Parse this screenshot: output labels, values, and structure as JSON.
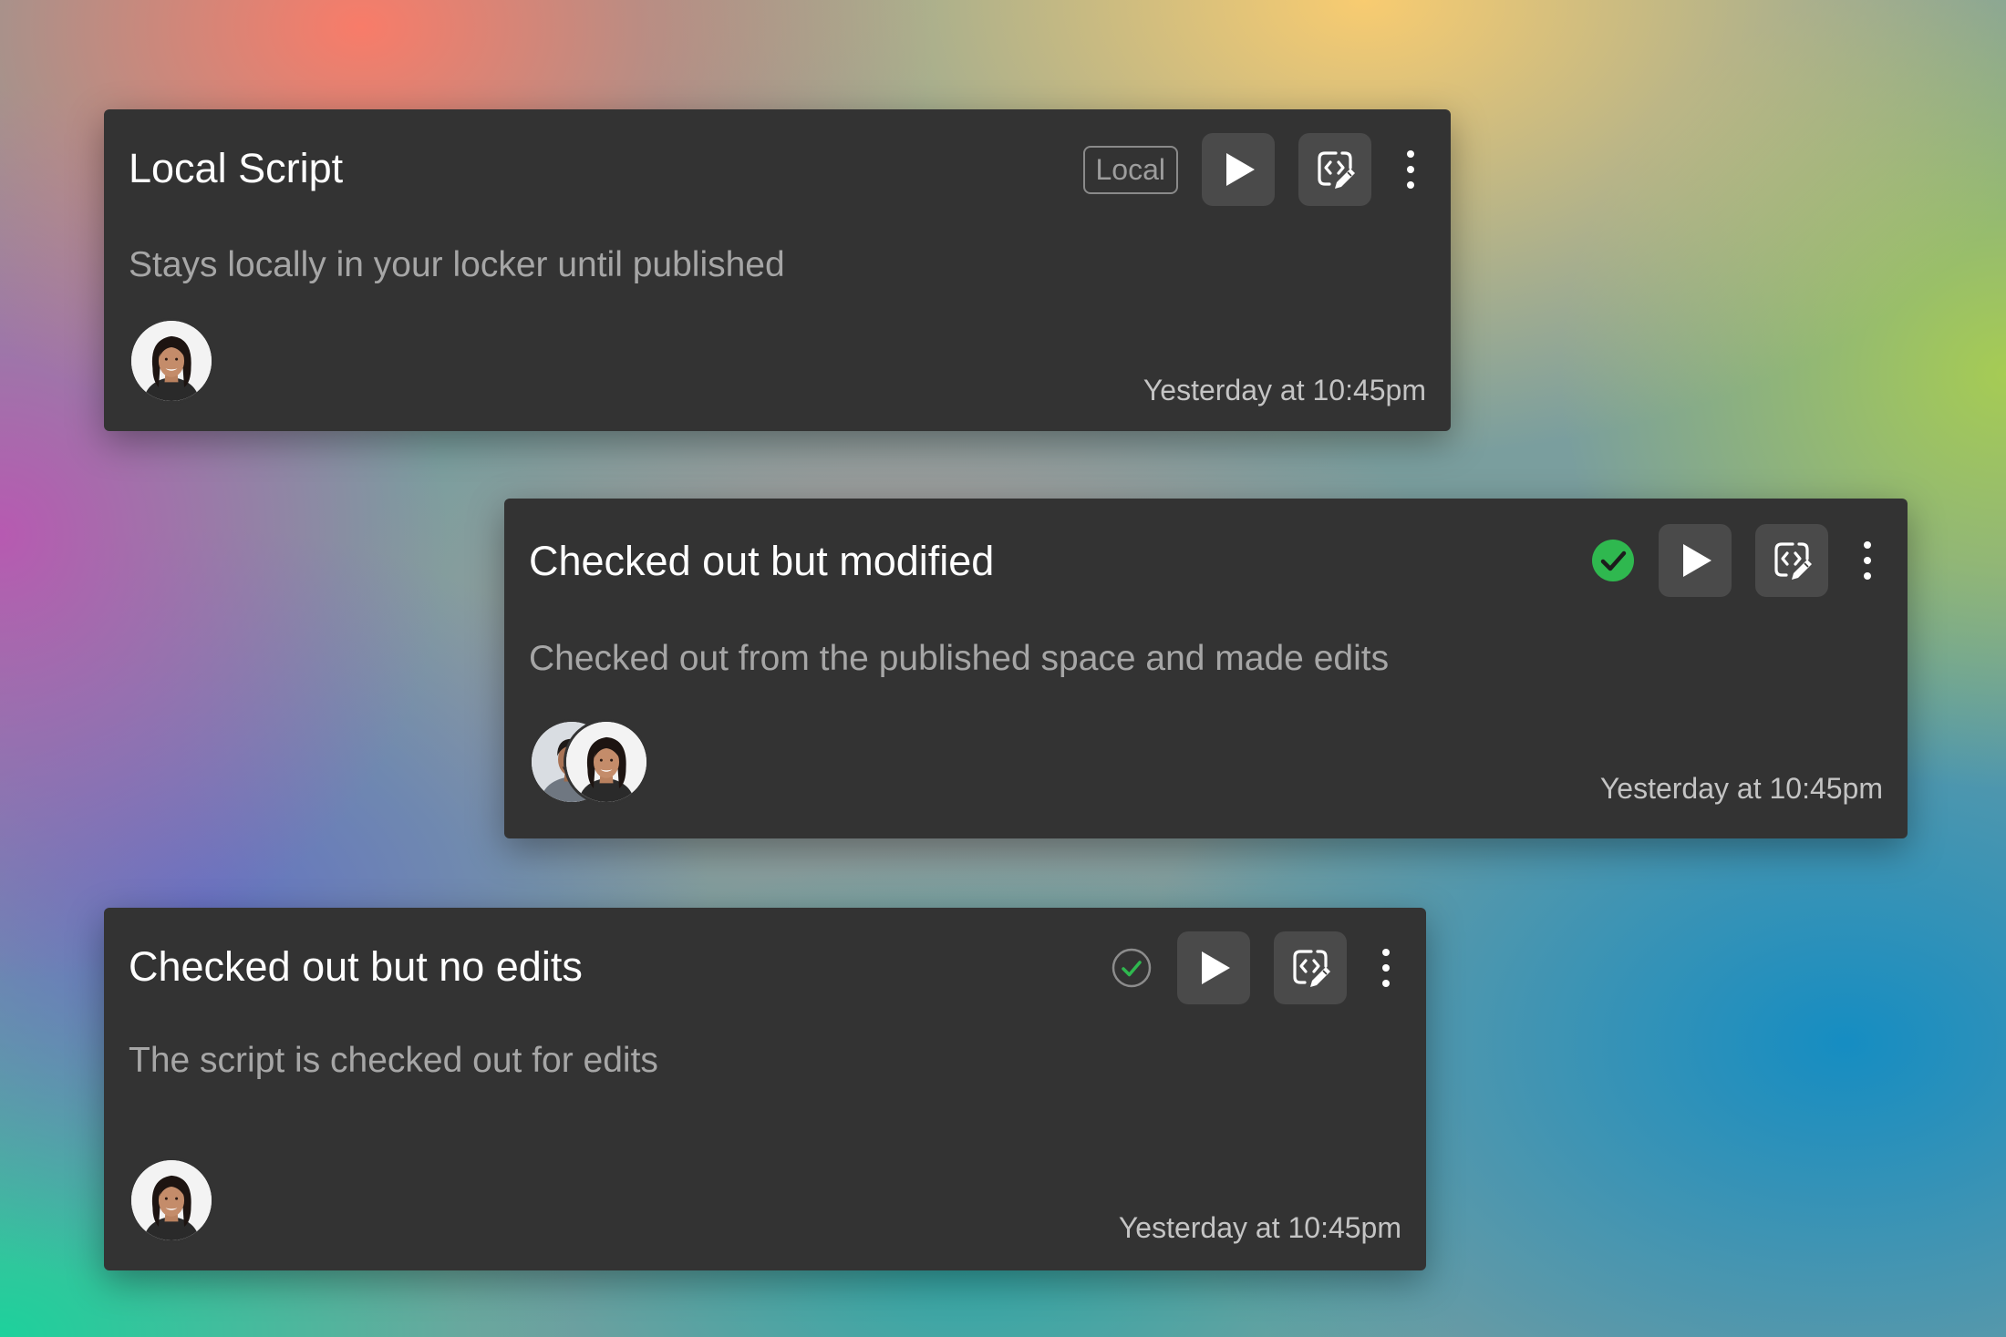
{
  "cards": [
    {
      "title": "Local Script",
      "description": "Stays locally in your locker until published",
      "badge": "Local",
      "status": "local",
      "timestamp": "Yesterday at 10:45pm",
      "avatars": [
        "woman-avatar"
      ],
      "actions": [
        "play-icon",
        "code-edit-icon",
        "more-vertical-icon"
      ]
    },
    {
      "title": "Checked out but modified",
      "description": "Checked out from the published space and made edits",
      "status": "modified",
      "status_icon": "check-circle-filled-icon",
      "status_color": "#2fb84f",
      "timestamp": "Yesterday at 10:45pm",
      "avatars": [
        "man-avatar",
        "woman-avatar"
      ],
      "actions": [
        "play-icon",
        "code-edit-icon",
        "more-vertical-icon"
      ]
    },
    {
      "title": "Checked out but no edits",
      "description": "The script is checked out for edits",
      "status": "checked-out",
      "status_icon": "check-circle-outline-icon",
      "status_color": "#2fb84f",
      "timestamp": "Yesterday at 10:45pm",
      "avatars": [
        "woman-avatar"
      ],
      "actions": [
        "play-icon",
        "code-edit-icon",
        "more-vertical-icon"
      ]
    }
  ]
}
